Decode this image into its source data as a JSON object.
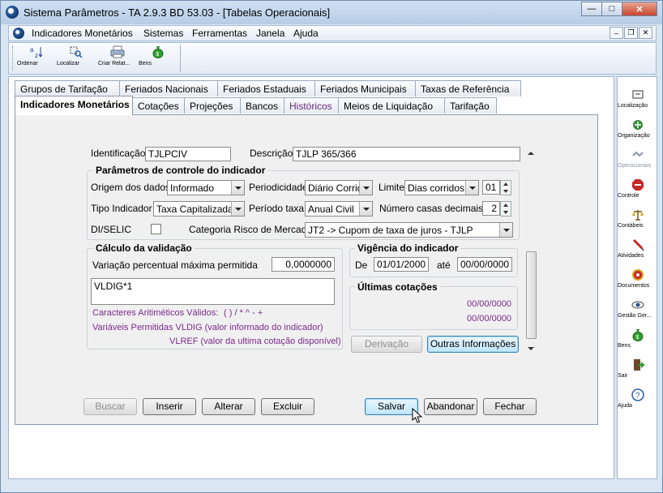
{
  "window": {
    "title": "Sistema Parâmetros -  TA 2.9.3 BD 53.03 - [Tabelas Operacionais]"
  },
  "menu": [
    "Indicadores Monetários",
    "Sistemas",
    "Ferramentas",
    "Janela",
    "Ajuda"
  ],
  "toolbar": [
    {
      "label": "Ordenar",
      "icon": "sort-az-icon"
    },
    {
      "label": "Localizar",
      "icon": "find-icon"
    },
    {
      "label": "Criar Relat...",
      "icon": "printer-icon"
    },
    {
      "label": "Bens",
      "icon": "money-bag-icon"
    }
  ],
  "tabs_row1": [
    "Grupos de Tarifação",
    "Feriados Nacionais",
    "Feriados Estaduais",
    "Feriados Municipais",
    "Taxas de Referência"
  ],
  "tabs_row2": [
    "Indicadores Monetários",
    "Cotações",
    "Projeções",
    "Bancos",
    "Históricos",
    "Meios de Liquidação",
    "Tarifação"
  ],
  "form": {
    "identificacao_label": "Identificação",
    "identificacao_value": "TJLPCIV",
    "descricao_label": "Descrição",
    "descricao_value": "TJLP 365/366",
    "params_title": "Parâmetros de controle do indicador",
    "origem_label": "Origem dos dados",
    "origem_value": "Informado",
    "periodicidade_label": "Periodicidade",
    "periodicidade_value": "Diário Corrido",
    "limite_label": "Limite",
    "limite_value": "Dias corridos",
    "limite_num": "01",
    "tipo_label": "Tipo Indicador",
    "tipo_value": "Taxa Capitalizada",
    "periodo_label": "Período taxa",
    "periodo_value": "Anual Civil",
    "casas_label": "Número casas decimais",
    "casas_value": "2",
    "diselic_label": "DI/SELIC",
    "categoria_label": "Categoria Risco de Mercado",
    "categoria_value": "JT2 -> Cupom de taxa de juros - TJLP",
    "calc_title": "Cálculo da validação",
    "variacao_label": "Variação percentual máxima permitida",
    "variacao_value": "0,0000000",
    "formula_value": "VLDIG*1",
    "caracteres_label": "Caracteres Aritiméticos Válidos:",
    "caracteres_value": "( ) / * ^ - +",
    "variaveis_label": "Variáveis Permitidas VLDIG  (valor informado do indicador)",
    "vlref_label": "VLREF (valor da ultima cotação disponível)",
    "vigencia_title": "Vigência do indicador",
    "de_label": "De",
    "de_value": "01/01/2000",
    "ate_label": "até",
    "ate_value": "00/00/0000",
    "cotacoes_title": "Últimas cotações",
    "cotacao1": "00/00/0000",
    "cotacao2": "00/00/0000",
    "derivacao_label": "Derivação",
    "outras_label": "Outras Informações"
  },
  "actions": {
    "buscar": "Buscar",
    "inserir": "Inserir",
    "alterar": "Alterar",
    "excluir": "Excluir",
    "salvar": "Salvar",
    "abandonar": "Abandonar",
    "fechar": "Fechar"
  },
  "sidebar": [
    {
      "label": "Localização",
      "icon": "location-icon"
    },
    {
      "label": "Organização",
      "icon": "organization-icon"
    },
    {
      "label": "Operacionais",
      "icon": "handshake-icon",
      "disabled": true
    },
    {
      "label": "Controle",
      "icon": "stop-sign-icon"
    },
    {
      "label": "Contábeis",
      "icon": "scales-icon"
    },
    {
      "label": "Atividades",
      "icon": "pen-icon"
    },
    {
      "label": "Documentos",
      "icon": "target-icon"
    },
    {
      "label": "Gestão Ger...",
      "icon": "eye-icon"
    },
    {
      "label": "Bens",
      "icon": "money-bag-icon"
    },
    {
      "label": "Sair",
      "icon": "exit-door-icon"
    },
    {
      "label": "Ajuda",
      "icon": "help-icon"
    }
  ]
}
